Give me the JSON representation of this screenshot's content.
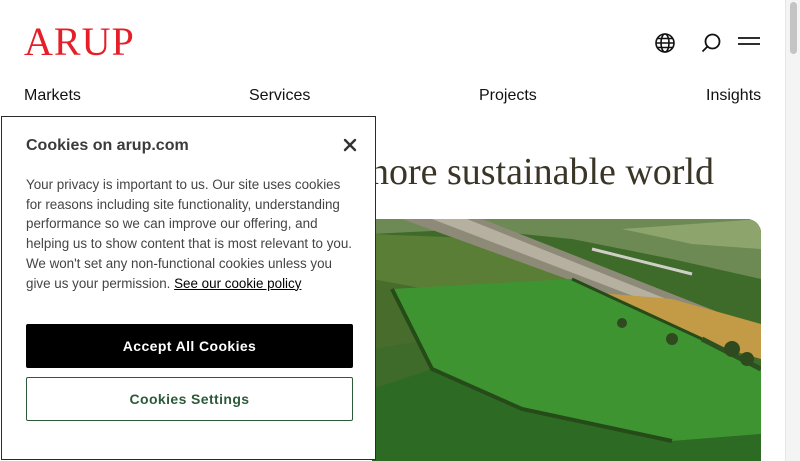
{
  "brand": {
    "logo_text": "ARUP",
    "color": "#e61e28"
  },
  "header_icons": [
    "globe-icon",
    "search-icon",
    "menu-icon"
  ],
  "nav": {
    "items": [
      {
        "label": "Markets"
      },
      {
        "label": "Services"
      },
      {
        "label": "Projects"
      },
      {
        "label": "Insights"
      }
    ]
  },
  "hero": {
    "headline_visible": "nore sustainable world"
  },
  "cookie_banner": {
    "title": "Cookies on arup.com",
    "body": "Your privacy is important to us. Our site uses cookies for reasons including site functionality, understanding performance so we can improve our offering, and helping us to show content that is most relevant to you. We won't set any non-functional cookies unless you give us your permission.",
    "policy_link": "See our cookie policy",
    "accept_label": "Accept All Cookies",
    "settings_label": "Cookies Settings",
    "accent_color": "#2d5a3a"
  }
}
